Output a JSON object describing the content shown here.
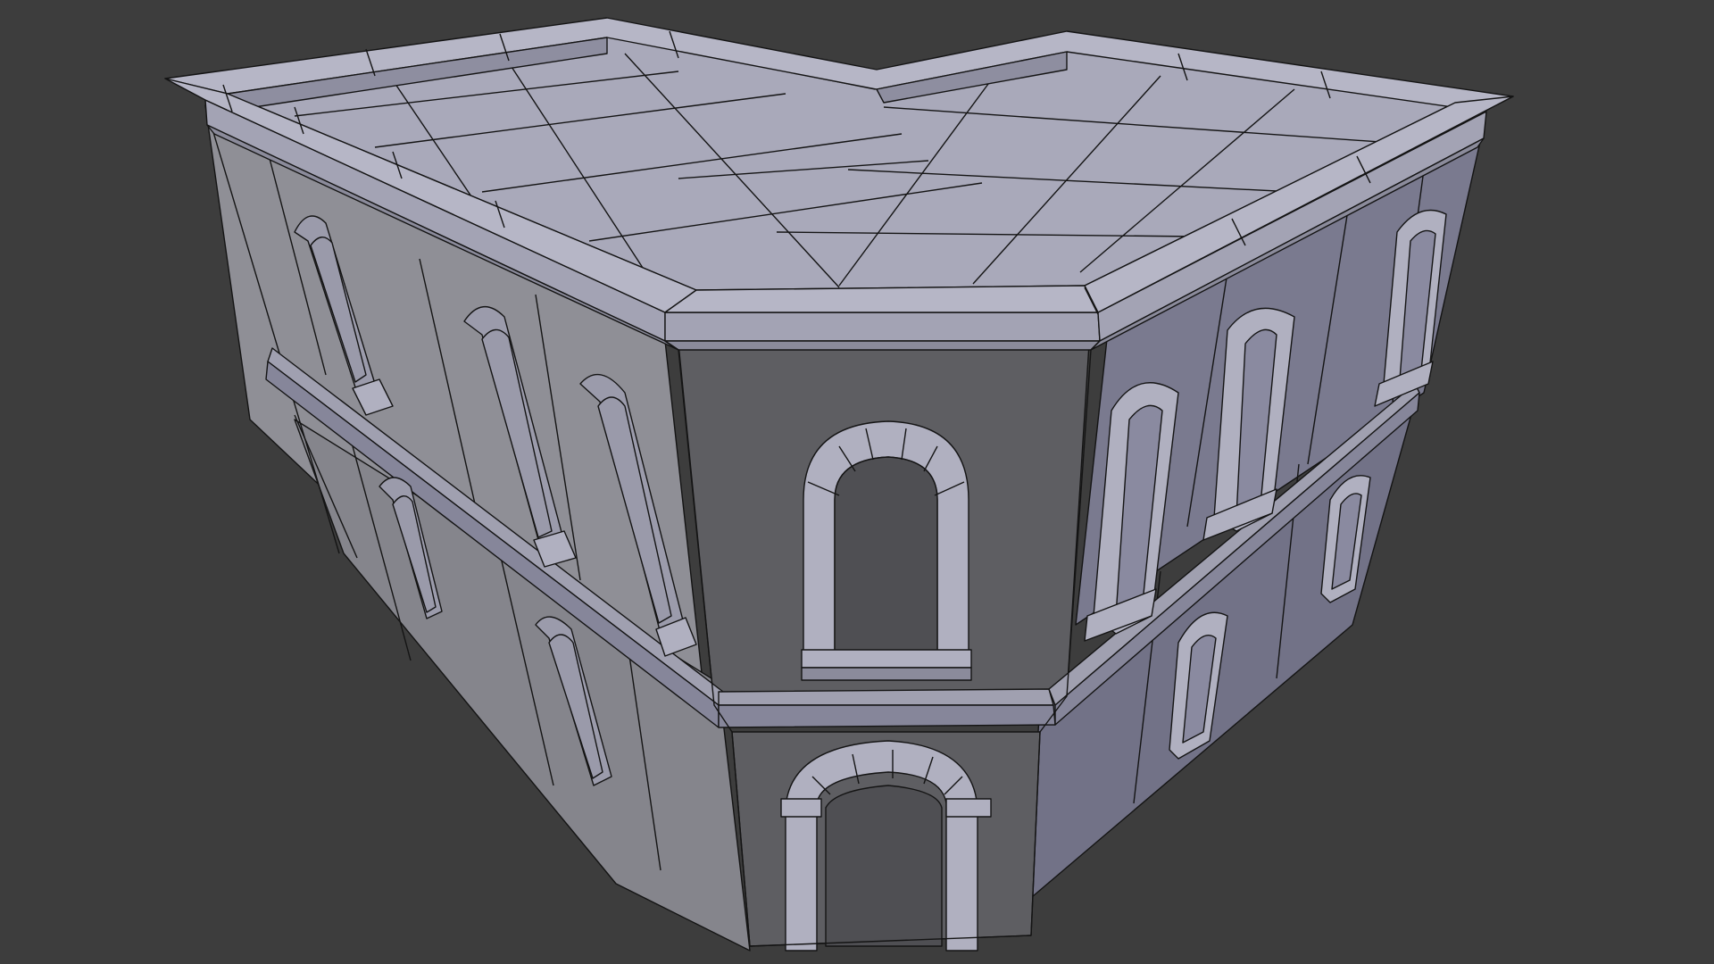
{
  "viewport": {
    "background": "#3d3d3d",
    "mode": "solid-shading-wireframe"
  },
  "model": {
    "type": "two-storey corner building",
    "colors": {
      "roof": "#a9a9ba",
      "wall_left": "#8f8f96",
      "wall_front": "#5e5e62",
      "wall_right": "#7a7a8f",
      "edges": "#141414"
    }
  }
}
